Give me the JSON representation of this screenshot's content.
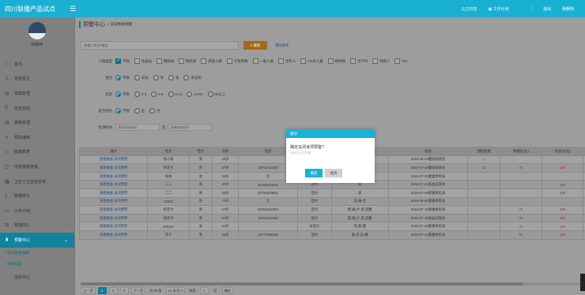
{
  "topbar": {
    "brand": "四川联播产品试点",
    "links": [
      "公卫日志",
      "工作计划",
      "退出",
      "杨朝伟"
    ]
  },
  "sidebar": {
    "user_name": "杨朝伟",
    "items": [
      {
        "label": "首页"
      },
      {
        "label": "家庭医生"
      },
      {
        "label": "档案管理"
      },
      {
        "label": "检查检验"
      },
      {
        "label": "慢病管理"
      },
      {
        "label": "预防接种"
      },
      {
        "label": "健康教育"
      },
      {
        "label": "中医健康管理"
      },
      {
        "label": "卫生计生监管协管"
      },
      {
        "label": "数据统计"
      },
      {
        "label": "工作计划"
      },
      {
        "label": "管理中心"
      },
      {
        "label": "预警中心"
      }
    ],
    "sub_items": [
      "异常数据预警",
      "阈值设置"
    ],
    "last_item": "消息中心"
  },
  "page": {
    "title": "预警中心",
    "breadcrumb": "» 异常数据预警"
  },
  "search": {
    "placeholder": "请输入姓名/电话",
    "button": "搜索",
    "clear": "清除条件"
  },
  "filters": {
    "crowd": {
      "label": "人群类型",
      "options": [
        "不限",
        "高血压",
        "糖尿病",
        "肺结核",
        "肝胆人群",
        "计生特殊",
        "一般人群",
        "老年人",
        "0-6岁儿童",
        "精神病",
        "孕产妇",
        "残疾人",
        "PM"
      ]
    },
    "gender": {
      "label": "性别",
      "options": [
        "不限",
        "未知",
        "男",
        "女",
        "未说明"
      ]
    },
    "age": {
      "label": "年龄",
      "options": [
        "不限",
        "0-3",
        "0-6",
        "0-14",
        "14-64",
        "65以上"
      ]
    },
    "signed": {
      "label": "是否签约",
      "options": [
        "不限",
        "是",
        "否"
      ]
    },
    "time": {
      "label": "检测时间",
      "start_placeholder": "选择开始时间",
      "to": "至",
      "end_placeholder": "选择结束时间"
    }
  },
  "table": {
    "headers": [
      "操作",
      "姓名",
      "性别",
      "年龄",
      "电话",
      "签约状态",
      "人群类型",
      "来源",
      "随机血糖",
      "收缩压(左)",
      "舒张压(左)",
      "血尿酸",
      "总胆固醇"
    ],
    "op_label": "查看数据 关闭预警",
    "rows": [
      [
        "查看数据 关闭预警",
        "独小夜",
        "男",
        "29岁",
        "",
        "签约",
        "",
        "2019-08-13糖尿病随访",
        "7",
        "",
        "",
        "",
        ""
      ],
      [
        "查看数据 关闭预警",
        "杨老大",
        "男",
        "57岁",
        "18781182283",
        "签约",
        "",
        "2019-07-16糖尿病随访",
        "20",
        "75",
        "105",
        "",
        ""
      ],
      [
        "查看数据 关闭预警",
        "陈杨",
        "女",
        "36岁",
        "无",
        "签约",
        "孕",
        "2019-07-29健康体检表",
        "",
        "",
        "",
        "",
        ""
      ],
      [
        "查看数据 关闭预警",
        "二二",
        "男",
        "40岁",
        "15708478521",
        "签约",
        "高",
        "2019-07-22高血压随访",
        "",
        "",
        "100",
        "",
        ""
      ],
      [
        "查看数据 关闭预警",
        "二二",
        "男",
        "40岁",
        "15708478521",
        "签约",
        "高",
        "2019-07-29健康体检表",
        "",
        "",
        "109",
        "",
        ""
      ],
      [
        "查看数据 关闭预警",
        "02901",
        "男",
        "70岁",
        "无",
        "签约",
        "高,痛,老",
        "2019-05-30健康体检表",
        "",
        "",
        "",
        "",
        ""
      ],
      [
        "查看数据 关闭预警",
        "杨老大",
        "男",
        "57岁",
        "18781182283",
        "签约",
        "肺,痛,计,老,高糖",
        "2019-07-16健康体检表",
        "",
        "75",
        "105",
        "",
        ""
      ],
      [
        "查看数据 关闭预警",
        "杨老大",
        "男",
        "57岁",
        "18781182283",
        "签约",
        "肺,痛,计,老,高糖",
        "2019-07-16高血压随访",
        "",
        "75",
        "105",
        "",
        ""
      ],
      [
        "查看数据 关闭预警",
        "070407",
        "女",
        "51岁",
        "",
        "未签约",
        "高,肺,糖",
        "2019-07-29健康体检表",
        "",
        "70",
        "110",
        "",
        ""
      ],
      [
        "查看数据 关闭预警",
        "李宁",
        "男",
        "65岁",
        "13772455255",
        "签约",
        "痛,老,高,糖",
        "2019-07-12健康体检表",
        "",
        "60",
        "100",
        "",
        ""
      ]
    ],
    "red_cols": [
      8,
      9,
      10
    ]
  },
  "pager": {
    "prev": "上一页",
    "pages": [
      "1",
      "2",
      "3"
    ],
    "next": "下一页",
    "total": "共 29 条",
    "per_page": "10 条/页",
    "goto": "到第",
    "goto_value": "1",
    "page_unit": "页",
    "confirm": "确定"
  },
  "dialog": {
    "title": "提示",
    "message": "确定关闭该项预警?",
    "sub": "关闭后无法恢复",
    "ok": "确定",
    "cancel": "取消"
  },
  "colors": {
    "accent": "#1ab0d3",
    "active_nav": "#11839e",
    "search_btn": "#a26a17",
    "warn_value": "#a12a2a"
  }
}
